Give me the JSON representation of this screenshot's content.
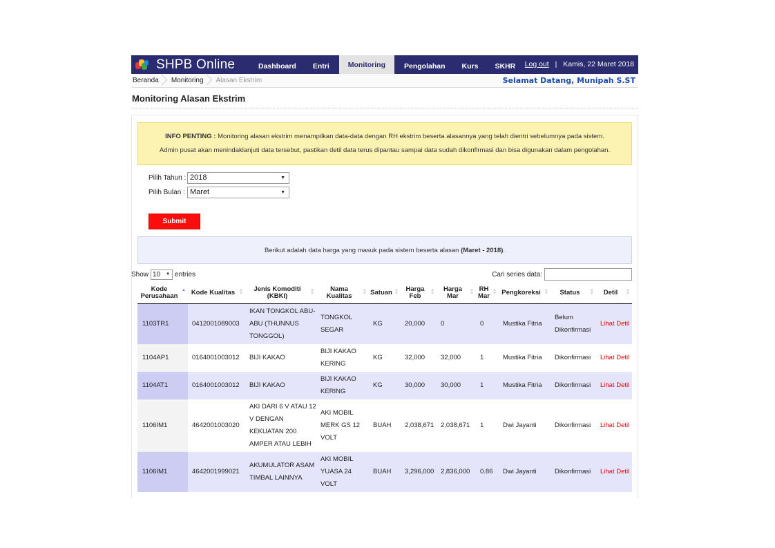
{
  "app": {
    "name": "SHPB Online"
  },
  "nav": {
    "dashboard": "Dashboard",
    "entri": "Entri",
    "monitoring": "Monitoring",
    "pengolahan": "Pengolahan",
    "kurs": "Kurs",
    "skhr": "SKHR"
  },
  "topright": {
    "logout": "Log out",
    "sep": "|",
    "date": "Kamis, 22 Maret 2018"
  },
  "breadcrumb": {
    "home": "Beranda",
    "monitoring": "Monitoring",
    "current": "Alasan Ekstrim"
  },
  "welcome": "Selamat Datang, Munipah S.ST",
  "page_title": "Monitoring Alasan Ekstrim",
  "info": {
    "label": "INFO PENTING :",
    "line1": "Monitoring alasan ekstrim menampilkan data-data dengan RH ekstrim beserta alasannya yang telah dientri sebelumnya pada sistem.",
    "line2": "Admin pusat akan menindaklanjuti data tersebut, pastikan detil data terus dipantau sampai data sudah dikonfirmasi dan bisa digunakan dalam pengolahan."
  },
  "filter": {
    "tahun_label": "Pilih Tahun",
    "tahun_value": "2018",
    "bulan_label": "Pilih Bulan",
    "bulan_value": "Maret",
    "colon": ":"
  },
  "submit_label": "Submit",
  "note": {
    "text": "Berikut adalah data harga yang masuk pada sistem beserta alasan ",
    "period": "(Maret - 2018)",
    "end": "."
  },
  "datatable": {
    "show": "Show",
    "length": "10",
    "entries": "entries",
    "search_label": "Cari series data:"
  },
  "table": {
    "headers": [
      "Kode Perusahaan",
      "Kode Kualitas",
      "Jenis Komoditi (KBKI)",
      "Nama Kualitas",
      "Satuan",
      "Harga Feb",
      "Harga Mar",
      "RH Mar",
      "Pengkoreksi",
      "Status",
      "Detil"
    ],
    "rows": [
      {
        "kode_perusahaan": "1103TR1",
        "kode_kualitas": "0412001089003",
        "jenis": "IKAN TONGKOL ABU-ABU (THUNNUS TONGGOL)",
        "nama": "TONGKOL SEGAR",
        "satuan": "KG",
        "harga_feb": "20,000",
        "harga_mar": "0",
        "rh": "0",
        "pengkoreksi": "Mustika Fitria",
        "status": "Belum Dikonfirmasi",
        "detil": "Lihat Detil"
      },
      {
        "kode_perusahaan": "1104AP1",
        "kode_kualitas": "0164001003012",
        "jenis": "BIJI KAKAO",
        "nama": "BIJI KAKAO KERING",
        "satuan": "KG",
        "harga_feb": "32,000",
        "harga_mar": "32,000",
        "rh": "1",
        "pengkoreksi": "Mustika Fitria",
        "status": "Dikonfirmasi",
        "detil": "Lihat Detil"
      },
      {
        "kode_perusahaan": "1104AT1",
        "kode_kualitas": "0164001003012",
        "jenis": "BIJI KAKAO",
        "nama": "BIJI KAKAO KERING",
        "satuan": "KG",
        "harga_feb": "30,000",
        "harga_mar": "30,000",
        "rh": "1",
        "pengkoreksi": "Mustika Fitria",
        "status": "Dikonfirmasi",
        "detil": "Lihat Detil"
      },
      {
        "kode_perusahaan": "1106IM1",
        "kode_kualitas": "4642001003020",
        "jenis": "AKI DARI 6 V ATAU 12 V DENGAN KEKUATAN 200 AMPER ATAU LEBIH",
        "nama": "AKI MOBIL MERK GS 12 VOLT",
        "satuan": "BUAH",
        "harga_feb": "2,038,671",
        "harga_mar": "2,038,671",
        "rh": "1",
        "pengkoreksi": "Dwi Jayanti",
        "status": "Dikonfirmasi",
        "detil": "Lihat Detil"
      },
      {
        "kode_perusahaan": "1106IM1",
        "kode_kualitas": "4642001999021",
        "jenis": "AKUMULATOR ASAM TIMBAL LAINNYA",
        "nama": "AKI MOBIL YUASA 24 VOLT",
        "satuan": "BUAH",
        "harga_feb": "3,296,000",
        "harga_mar": "2,836,000",
        "rh": "0.86",
        "pengkoreksi": "Dwi Jayanti",
        "status": "Dikonfirmasi",
        "detil": "Lihat Detil"
      }
    ]
  },
  "colors": {
    "topbar": "#2b2c70",
    "submit": "#fb0d0d",
    "link": "#e60000",
    "info_bg": "#fcf3b3",
    "row_odd": "#e4e4fb"
  },
  "icons": {
    "logo": "shpb-logo-icon",
    "sort": "sort-arrows-icon",
    "dropdown": "chevron-down-icon"
  }
}
